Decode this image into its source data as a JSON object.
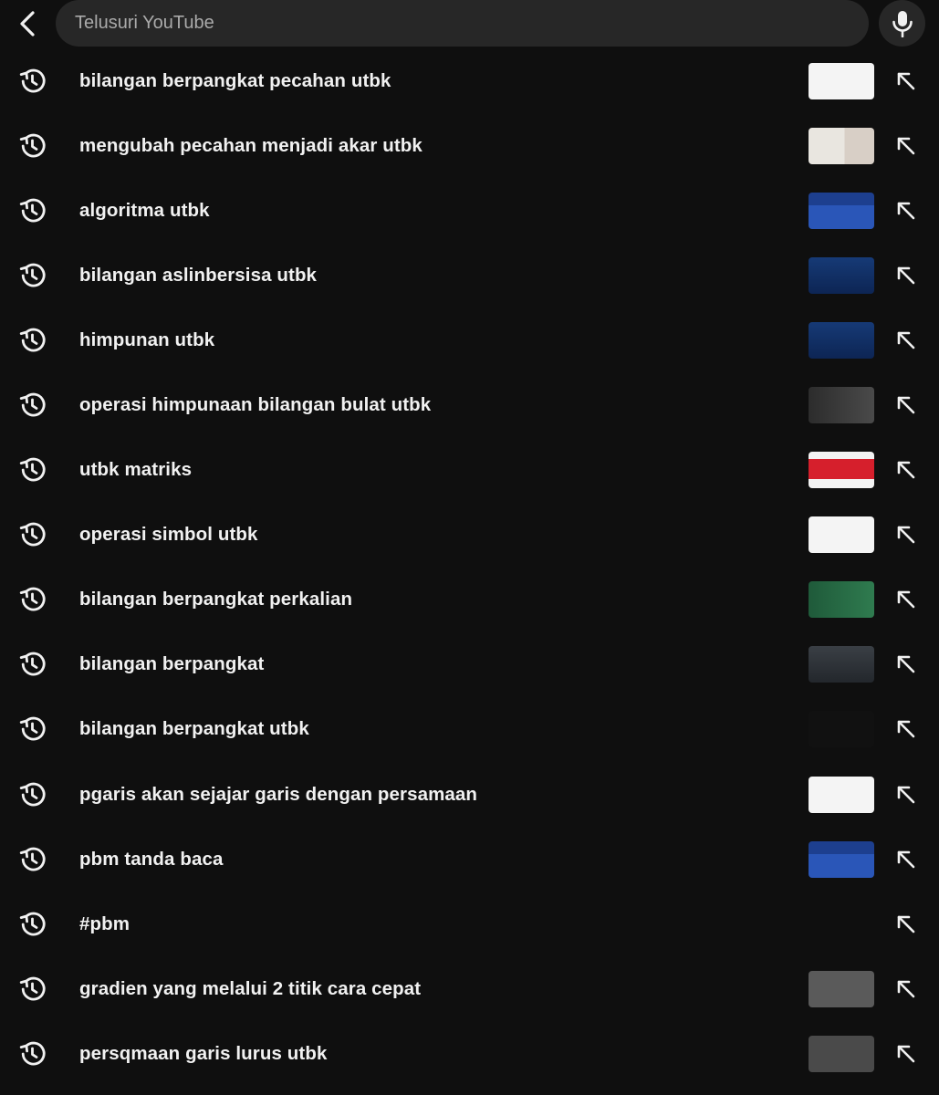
{
  "search": {
    "placeholder": "Telusuri YouTube",
    "value": ""
  },
  "suggestions": [
    {
      "label": "bilangan berpangkat pecahan utbk",
      "thumbnail": "white"
    },
    {
      "label": "mengubah pecahan menjadi akar utbk",
      "thumbnail": "paper"
    },
    {
      "label": "algoritma utbk",
      "thumbnail": "blue"
    },
    {
      "label": "bilangan aslinbersisa utbk",
      "thumbnail": "navy"
    },
    {
      "label": "himpunan utbk",
      "thumbnail": "navy"
    },
    {
      "label": "operasi himpunaan bilangan bulat utbk",
      "thumbnail": "dark"
    },
    {
      "label": "utbk matriks",
      "thumbnail": "red"
    },
    {
      "label": "operasi simbol utbk",
      "thumbnail": "white"
    },
    {
      "label": "bilangan berpangkat perkalian",
      "thumbnail": "green"
    },
    {
      "label": "bilangan berpangkat",
      "thumbnail": "slate"
    },
    {
      "label": "bilangan berpangkat utbk",
      "thumbnail": "yellow"
    },
    {
      "label": "pgaris akan sejajar garis dengan persamaan",
      "thumbnail": "white"
    },
    {
      "label": "pbm tanda baca",
      "thumbnail": "blue"
    },
    {
      "label": "#pbm",
      "thumbnail": null
    },
    {
      "label": "gradien yang melalui 2 titik cara cepat",
      "thumbnail": "grey"
    },
    {
      "label": "persqmaan garis lurus utbk",
      "thumbnail": "grey2"
    }
  ],
  "icons": {
    "back": "chevron-left-icon",
    "mic": "microphone-icon",
    "history": "history-icon",
    "fill": "arrow-up-left-icon"
  },
  "colors": {
    "background": "#0f0f0f",
    "surface": "#272727",
    "text": "#f1f1f1",
    "placeholder": "#aaaaaa"
  }
}
